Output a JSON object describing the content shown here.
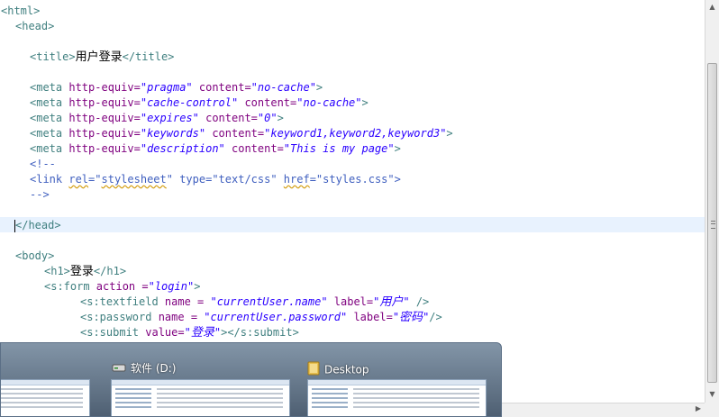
{
  "code": {
    "line_html": "<html>",
    "line_head_open": "<head>",
    "title_open": "<title>",
    "title_text": "用户登录",
    "title_close": "</title>",
    "meta1": {
      "tag": "<meta",
      "a1": "http-equiv=",
      "v1": "\"pragma\"",
      "a2": "content=",
      "v2": "\"no-cache\"",
      "end": ">"
    },
    "meta2": {
      "tag": "<meta",
      "a1": "http-equiv=",
      "v1": "\"cache-control\"",
      "a2": "content=",
      "v2": "\"no-cache\"",
      "end": ">"
    },
    "meta3": {
      "tag": "<meta",
      "a1": "http-equiv=",
      "v1": "\"expires\"",
      "a2": "content=",
      "v2": "\"0\"",
      "end": ">"
    },
    "meta4": {
      "tag": "<meta",
      "a1": "http-equiv=",
      "v1": "\"keywords\"",
      "a2": "content=",
      "v2": "\"keyword1,keyword2,keyword3\"",
      "end": ">"
    },
    "meta5": {
      "tag": "<meta",
      "a1": "http-equiv=",
      "v1": "\"description\"",
      "a2": "content=",
      "v2": "\"This is my page\"",
      "end": ">"
    },
    "comment_open": "<!--",
    "link_a": "<link ",
    "link_rel": "rel",
    "link_b": "=\"",
    "link_ss": "stylesheet",
    "link_c": "\" type=\"text/css\" ",
    "link_href": "href",
    "link_d": "=\"styles.css\">",
    "comment_close": "-->",
    "head_close_lt": "<",
    "head_close_rest": "/head>",
    "body_open": "<body>",
    "h1_open": "<h1>",
    "h1_text": "登录",
    "h1_close": "</h1>",
    "form": {
      "tag": "<s:form",
      "a1": " action =",
      "v1": "\"login\"",
      "end": ">"
    },
    "textfield": {
      "tag": "<s:textfield",
      "a1": " name = ",
      "v1": "\"currentUser.name\"",
      "a2": " label=",
      "q1": "\"",
      "label": "用户",
      "q2": "\"",
      "end": " />"
    },
    "password": {
      "tag": "<s:password",
      "a1": " name = ",
      "v1": "\"currentUser.password\"",
      "a2": " label=",
      "q1": "\"",
      "label": "密码",
      "q2": "\"",
      "end": "/>"
    },
    "submit": {
      "tag": "<s:submit",
      "a1": " value=",
      "q1": "\"",
      "label": "登录",
      "q2": "\"",
      "end": "></s:submit>"
    }
  },
  "taskbar": {
    "items": [
      {
        "title": ""
      },
      {
        "title": "软件 (D:)",
        "icon": "drive-icon"
      },
      {
        "title": "Desktop",
        "icon": "folder-icon"
      }
    ]
  },
  "colors": {
    "tag": "#3f7f7f",
    "attribute": "#7f007f",
    "value": "#2a00ff",
    "comment": "#3f5fbf",
    "current_line": "#e8f2fe"
  }
}
